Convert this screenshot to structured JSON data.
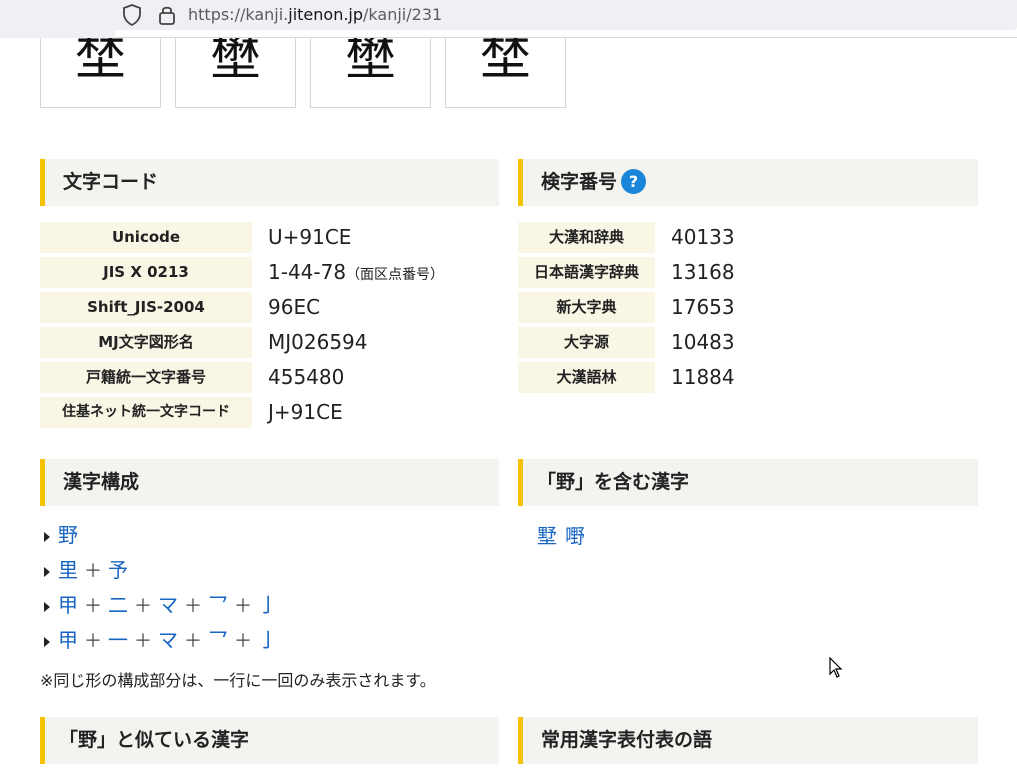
{
  "browser": {
    "url_prefix": "https://kanji.",
    "url_host": "jitenon.jp",
    "url_path": "/kanji/231"
  },
  "variant_tiles": [
    "埜",
    "壄",
    "壄",
    "埜"
  ],
  "moji_code": {
    "title": "文字コード",
    "rows": [
      {
        "label": "Unicode",
        "value": "U+91CE",
        "note": ""
      },
      {
        "label": "JIS X 0213",
        "value": "1-44-78",
        "note": "（面区点番号）"
      },
      {
        "label": "Shift_JIS-2004",
        "value": "96EC",
        "note": ""
      },
      {
        "label": "MJ文字図形名",
        "value": "MJ026594",
        "note": ""
      },
      {
        "label": "戸籍統一文字番号",
        "value": "455480",
        "note": ""
      },
      {
        "label": "住基ネット統一文字コード",
        "value": "J+91CE",
        "note": ""
      }
    ]
  },
  "kenji_bango": {
    "title": "検字番号",
    "help_icon": "?",
    "rows": [
      {
        "label": "大漢和辞典",
        "value": "40133"
      },
      {
        "label": "日本語漢字辞典",
        "value": "13168"
      },
      {
        "label": "新大字典",
        "value": "17653"
      },
      {
        "label": "大字源",
        "value": "10483"
      },
      {
        "label": "大漢語林",
        "value": "11884"
      }
    ]
  },
  "kanji_kousei": {
    "title": "漢字構成",
    "lines": [
      [
        "野"
      ],
      [
        "里",
        "予"
      ],
      [
        "甲",
        "二",
        "マ",
        "乛",
        "亅"
      ],
      [
        "甲",
        "一",
        "マ",
        "乛",
        "亅"
      ]
    ],
    "plus": "＋",
    "note": "※同じ形の構成部分は、一行に一回のみ表示されます。"
  },
  "containing": {
    "title": "「野」を含む漢字",
    "items": [
      "墅",
      "嘢"
    ]
  },
  "similar": {
    "title": "「野」と似ている漢字"
  },
  "joyo": {
    "title": "常用漢字表付表の語"
  },
  "colors": {
    "accent": "#f5c300",
    "link": "#1765c1",
    "label_bg": "#faf6e6",
    "header_bg": "#f3f3f0"
  }
}
